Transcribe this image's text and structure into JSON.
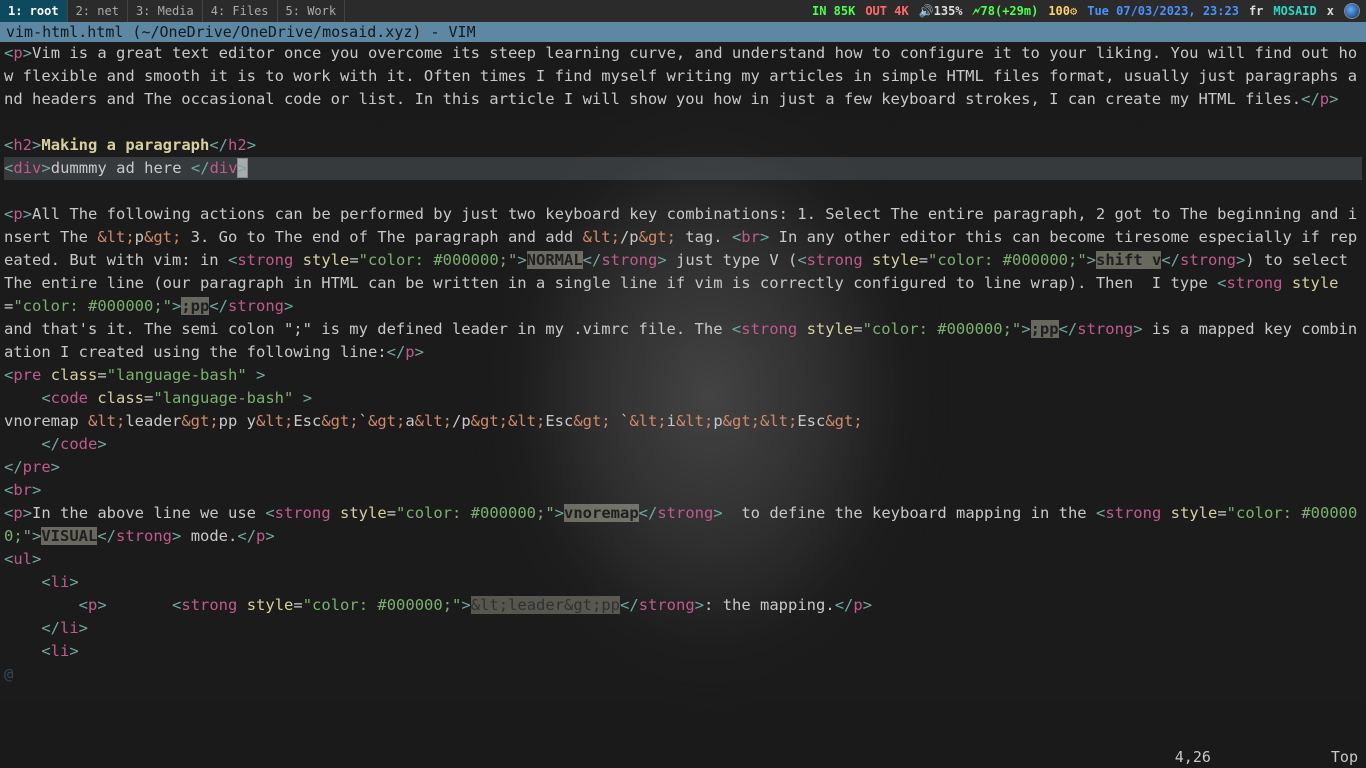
{
  "topbar": {
    "tabs": [
      {
        "label": "1: root",
        "active": true
      },
      {
        "label": "2: net",
        "active": false
      },
      {
        "label": "3: Media",
        "active": false
      },
      {
        "label": "4: Files",
        "active": false
      },
      {
        "label": "5: Work",
        "active": false
      }
    ],
    "net_in": "IN 85K",
    "net_out": "OUT 4K",
    "volume": "🔊135%",
    "battery": "🗲78(+29m)",
    "cpu": "100⚙",
    "clock": "Tue 07/03/2023, 23:23",
    "kb_layout": "fr",
    "brand": "MOSAID",
    "close": "x"
  },
  "vim": {
    "titlebar": "vim-html.html (~/OneDrive/OneDrive/mosaid.xyz) - VIM",
    "ruler_pos": "4,26",
    "ruler_scroll": "Top",
    "cursor": {
      "line_index": 3,
      "col": 25
    },
    "lines": [
      [
        [
          "punct",
          "<"
        ],
        [
          "tag",
          "p"
        ],
        [
          "punct",
          ">"
        ],
        [
          "text",
          "Vim is a great text editor once you overcome its steep learning curve, and understand how to configure it to your liking. You will find out how flexible and smooth it is to work with it. Often times I find myself writing my articles in simple HTML files format, usually just paragraphs and headers and The occasional code or list. In this article I will show you how in just a few keyboard strokes, I can create my HTML files."
        ],
        [
          "punct",
          "</"
        ],
        [
          "tag",
          "p"
        ],
        [
          "punct",
          ">"
        ]
      ],
      [],
      [
        [
          "punct",
          "<"
        ],
        [
          "tag",
          "h2"
        ],
        [
          "punct",
          ">"
        ],
        [
          "head",
          "Making a paragraph"
        ],
        [
          "punct",
          "</"
        ],
        [
          "tag",
          "h2"
        ],
        [
          "punct",
          ">"
        ]
      ],
      [
        [
          "punct",
          "<"
        ],
        [
          "tag",
          "div"
        ],
        [
          "punct",
          ">"
        ],
        [
          "text",
          "dummmy ad here "
        ],
        [
          "punct",
          "</"
        ],
        [
          "tag",
          "div"
        ],
        [
          "punct",
          ">"
        ]
      ],
      [],
      [
        [
          "punct",
          "<"
        ],
        [
          "tag",
          "p"
        ],
        [
          "punct",
          ">"
        ],
        [
          "text",
          "All The following actions can be performed by just two keyboard key combinations: 1. Select The entire paragraph, 2 got to The beginning and insert The "
        ],
        [
          "ent",
          "&lt;"
        ],
        [
          "text",
          "p"
        ],
        [
          "ent",
          "&gt;"
        ],
        [
          "text",
          " 3. Go to The end of The paragraph and add "
        ],
        [
          "ent",
          "&lt;"
        ],
        [
          "text",
          "/p"
        ],
        [
          "ent",
          "&gt;"
        ],
        [
          "text",
          " tag. "
        ],
        [
          "punct",
          "<"
        ],
        [
          "tag",
          "br"
        ],
        [
          "punct",
          ">"
        ],
        [
          "text",
          " In any other editor this can become tiresome especially if repeated. But with vim: in "
        ],
        [
          "punct",
          "<"
        ],
        [
          "tag",
          "strong"
        ],
        [
          "text",
          " "
        ],
        [
          "attr",
          "style"
        ],
        [
          "eq",
          "="
        ],
        [
          "str",
          "\"color: #000000;\""
        ],
        [
          "punct",
          ">"
        ],
        [
          "emph",
          "NORMAL"
        ],
        [
          "punct",
          "</"
        ],
        [
          "tag",
          "strong"
        ],
        [
          "punct",
          ">"
        ],
        [
          "text",
          " just type V ("
        ],
        [
          "punct",
          "<"
        ],
        [
          "tag",
          "strong"
        ],
        [
          "text",
          " "
        ],
        [
          "attr",
          "style"
        ],
        [
          "eq",
          "="
        ],
        [
          "str",
          "\"color: #000000;\""
        ],
        [
          "punct",
          ">"
        ],
        [
          "emph",
          "shift v"
        ],
        [
          "punct",
          "</"
        ],
        [
          "tag",
          "strong"
        ],
        [
          "punct",
          ">"
        ],
        [
          "text",
          ") to select The entire line (our paragraph in HTML can be written in a single line if vim is correctly configured to line wrap). Then  I type "
        ],
        [
          "punct",
          "<"
        ],
        [
          "tag",
          "strong"
        ],
        [
          "text",
          " "
        ],
        [
          "attr",
          "style"
        ],
        [
          "eq",
          "="
        ],
        [
          "str",
          "\"color: #000000;\""
        ],
        [
          "punct",
          ">"
        ],
        [
          "emph",
          ";pp"
        ],
        [
          "punct",
          "</"
        ],
        [
          "tag",
          "strong"
        ],
        [
          "punct",
          ">"
        ]
      ],
      [
        [
          "text",
          "and that's it. The semi colon \";\" is my defined leader in my .vimrc file. The "
        ],
        [
          "punct",
          "<"
        ],
        [
          "tag",
          "strong"
        ],
        [
          "text",
          " "
        ],
        [
          "attr",
          "style"
        ],
        [
          "eq",
          "="
        ],
        [
          "str",
          "\"color: #000000;\""
        ],
        [
          "punct",
          ">"
        ],
        [
          "emph",
          ";pp"
        ],
        [
          "punct",
          "</"
        ],
        [
          "tag",
          "strong"
        ],
        [
          "punct",
          ">"
        ],
        [
          "text",
          " is a mapped key combination I created using the following line:"
        ],
        [
          "punct",
          "</"
        ],
        [
          "tag",
          "p"
        ],
        [
          "punct",
          ">"
        ]
      ],
      [
        [
          "punct",
          "<"
        ],
        [
          "tag",
          "pre"
        ],
        [
          "text",
          " "
        ],
        [
          "attr",
          "class"
        ],
        [
          "eq",
          "="
        ],
        [
          "str",
          "\"language-bash\""
        ],
        [
          "text",
          " "
        ],
        [
          "punct",
          ">"
        ]
      ],
      [
        [
          "text",
          "    "
        ],
        [
          "punct",
          "<"
        ],
        [
          "tag",
          "code"
        ],
        [
          "text",
          " "
        ],
        [
          "attr",
          "class"
        ],
        [
          "eq",
          "="
        ],
        [
          "str",
          "\"language-bash\""
        ],
        [
          "text",
          " "
        ],
        [
          "punct",
          ">"
        ]
      ],
      [
        [
          "text",
          "vnoremap "
        ],
        [
          "ent",
          "&lt;"
        ],
        [
          "text",
          "leader"
        ],
        [
          "ent",
          "&gt;"
        ],
        [
          "text",
          "pp y"
        ],
        [
          "ent",
          "&lt;"
        ],
        [
          "text",
          "Esc"
        ],
        [
          "ent",
          "&gt;"
        ],
        [
          "text",
          "`"
        ],
        [
          "ent",
          "&gt;"
        ],
        [
          "text",
          "a"
        ],
        [
          "ent",
          "&lt;"
        ],
        [
          "text",
          "/p"
        ],
        [
          "ent",
          "&gt;&lt;"
        ],
        [
          "text",
          "Esc"
        ],
        [
          "ent",
          "&gt;"
        ],
        [
          "text",
          " `"
        ],
        [
          "ent",
          "&lt;"
        ],
        [
          "text",
          "i"
        ],
        [
          "ent",
          "&lt;"
        ],
        [
          "text",
          "p"
        ],
        [
          "ent",
          "&gt;&lt;"
        ],
        [
          "text",
          "Esc"
        ],
        [
          "ent",
          "&gt;"
        ]
      ],
      [
        [
          "text",
          "    "
        ],
        [
          "punct",
          "</"
        ],
        [
          "tag",
          "code"
        ],
        [
          "punct",
          ">"
        ]
      ],
      [
        [
          "punct",
          "</"
        ],
        [
          "tag",
          "pre"
        ],
        [
          "punct",
          ">"
        ]
      ],
      [
        [
          "punct",
          "<"
        ],
        [
          "tag",
          "br"
        ],
        [
          "punct",
          ">"
        ]
      ],
      [
        [
          "punct",
          "<"
        ],
        [
          "tag",
          "p"
        ],
        [
          "punct",
          ">"
        ],
        [
          "text",
          "In the above line we use "
        ],
        [
          "punct",
          "<"
        ],
        [
          "tag",
          "strong"
        ],
        [
          "text",
          " "
        ],
        [
          "attr",
          "style"
        ],
        [
          "eq",
          "="
        ],
        [
          "str",
          "\"color: #000000;\""
        ],
        [
          "punct",
          ">"
        ],
        [
          "emph",
          "vnoremap"
        ],
        [
          "punct",
          "</"
        ],
        [
          "tag",
          "strong"
        ],
        [
          "punct",
          ">"
        ],
        [
          "text",
          "  to define the keyboard mapping in the "
        ],
        [
          "punct",
          "<"
        ],
        [
          "tag",
          "strong"
        ],
        [
          "text",
          " "
        ],
        [
          "attr",
          "style"
        ],
        [
          "eq",
          "="
        ],
        [
          "str",
          "\"color: #000000;\""
        ],
        [
          "punct",
          ">"
        ],
        [
          "emph",
          "VISUAL"
        ],
        [
          "punct",
          "</"
        ],
        [
          "tag",
          "strong"
        ],
        [
          "punct",
          ">"
        ],
        [
          "text",
          " mode."
        ],
        [
          "punct",
          "</"
        ],
        [
          "tag",
          "p"
        ],
        [
          "punct",
          ">"
        ]
      ],
      [
        [
          "punct",
          "<"
        ],
        [
          "tag",
          "ul"
        ],
        [
          "punct",
          ">"
        ]
      ],
      [
        [
          "text",
          "    "
        ],
        [
          "punct",
          "<"
        ],
        [
          "tag",
          "li"
        ],
        [
          "punct",
          ">"
        ]
      ],
      [
        [
          "text",
          "        "
        ],
        [
          "punct",
          "<"
        ],
        [
          "tag",
          "p"
        ],
        [
          "punct",
          ">"
        ],
        [
          "text",
          "       "
        ],
        [
          "punct",
          "<"
        ],
        [
          "tag",
          "strong"
        ],
        [
          "text",
          " "
        ],
        [
          "attr",
          "style"
        ],
        [
          "eq",
          "="
        ],
        [
          "str",
          "\"color: #000000;\""
        ],
        [
          "punct",
          ">"
        ],
        [
          "emph2",
          "&lt;leader&gt;pp"
        ],
        [
          "punct",
          "</"
        ],
        [
          "tag",
          "strong"
        ],
        [
          "punct",
          ">"
        ],
        [
          "text",
          ": the mapping."
        ],
        [
          "punct",
          "</"
        ],
        [
          "tag",
          "p"
        ],
        [
          "punct",
          ">"
        ]
      ],
      [
        [
          "text",
          "    "
        ],
        [
          "punct",
          "</"
        ],
        [
          "tag",
          "li"
        ],
        [
          "punct",
          ">"
        ]
      ],
      [
        [
          "text",
          "    "
        ],
        [
          "punct",
          "<"
        ],
        [
          "tag",
          "li"
        ],
        [
          "punct",
          ">"
        ]
      ]
    ],
    "eob_marker": "@"
  }
}
